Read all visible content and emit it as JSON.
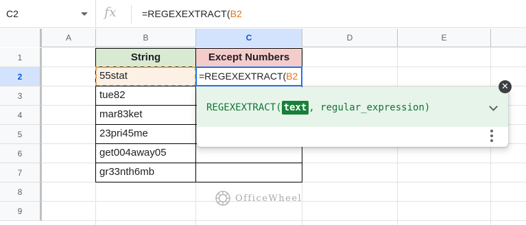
{
  "formula_bar": {
    "name_box": "C2",
    "fx_label": "fx",
    "formula_prefix": "=REGEXEXTRACT(",
    "formula_ref": "B2"
  },
  "columns": [
    "A",
    "B",
    "C",
    "D",
    "E"
  ],
  "rows": [
    "1",
    "2",
    "3",
    "4",
    "5",
    "6",
    "7",
    "8",
    "9"
  ],
  "table": {
    "header_b": "String",
    "header_c": "Except Numbers",
    "strings": [
      "55stat",
      "tue82",
      "mar83ket",
      "23pri45me",
      "get004away05",
      "gr33nth6mb"
    ],
    "active_prefix": "=REGEXEXTRACT(",
    "active_ref": "B2"
  },
  "autocomplete": {
    "fn_name": "REGEXEXTRACT(",
    "arg_active": "text",
    "arg_rest": ", regular_expression)"
  },
  "watermark": {
    "text": "OfficeWheel"
  },
  "colors": {
    "header_b_bg": "#d9ead3",
    "header_c_bg": "#f4cccc",
    "ref_orange": "#e8710a",
    "active_blue": "#1a73e8",
    "popup_green_bg": "#e6f4ea"
  },
  "icons": [
    "dropdown-caret-icon",
    "fx-icon",
    "close-icon",
    "chevron-down-icon",
    "more-vert-icon",
    "officewheel-logo-icon"
  ]
}
